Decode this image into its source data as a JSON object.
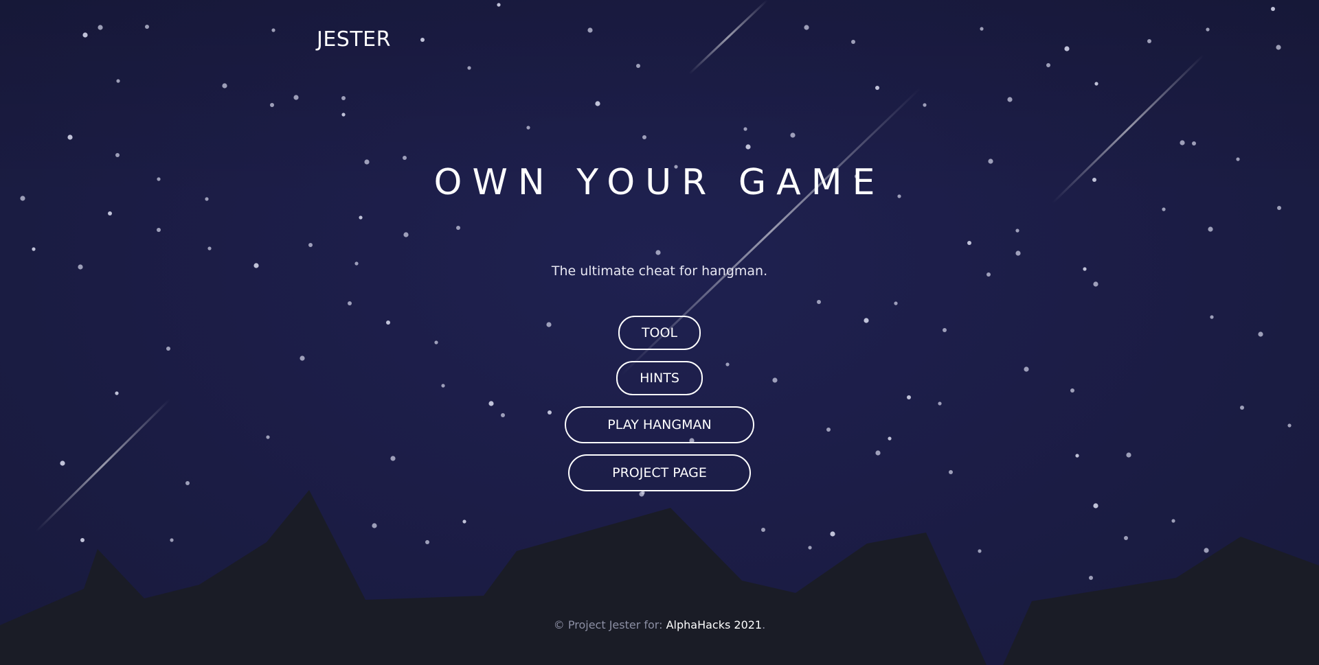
{
  "brand": {
    "name": "JESTER"
  },
  "hero": {
    "headline": "OWN YOUR GAME",
    "tagline": "The ultimate cheat for hangman."
  },
  "buttons": {
    "tool": "TOOL",
    "hints": "HINTS",
    "play_hangman": "PLAY HANGMAN",
    "project_page": "PROJECT PAGE"
  },
  "footer": {
    "prefix": "© Project Jester for: ",
    "link_text": "AlphaHacks 2021",
    "suffix": "."
  },
  "colors": {
    "sky": "#1c1d47",
    "mountains": "#1a1c26",
    "text": "#ffffff",
    "muted_text": "#8c8fa4",
    "stars": "#c9cbe0"
  }
}
